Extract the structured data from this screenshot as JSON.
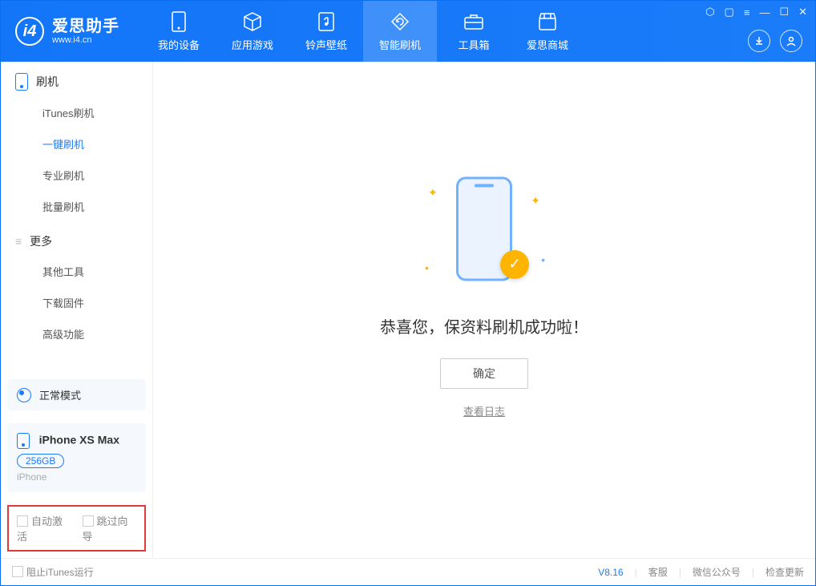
{
  "app": {
    "title": "爱思助手",
    "url": "www.i4.cn"
  },
  "nav": {
    "items": [
      {
        "label": "我的设备",
        "icon": "device"
      },
      {
        "label": "应用游戏",
        "icon": "cube"
      },
      {
        "label": "铃声壁纸",
        "icon": "music"
      },
      {
        "label": "智能刷机",
        "icon": "refresh",
        "active": true
      },
      {
        "label": "工具箱",
        "icon": "toolbox"
      },
      {
        "label": "爱思商城",
        "icon": "store"
      }
    ]
  },
  "sidebar": {
    "section1": {
      "title": "刷机"
    },
    "items1": [
      {
        "label": "iTunes刷机"
      },
      {
        "label": "一键刷机",
        "active": true
      },
      {
        "label": "专业刷机"
      },
      {
        "label": "批量刷机"
      }
    ],
    "section2": {
      "title": "更多"
    },
    "items2": [
      {
        "label": "其他工具"
      },
      {
        "label": "下载固件"
      },
      {
        "label": "高级功能"
      }
    ],
    "mode": {
      "label": "正常模式"
    },
    "device": {
      "name": "iPhone XS Max",
      "storage": "256GB",
      "type": "iPhone"
    },
    "opts": {
      "auto_activate": "自动激活",
      "skip_guide": "跳过向导"
    }
  },
  "main": {
    "success_text": "恭喜您，保资料刷机成功啦！",
    "ok_button": "确定",
    "log_link": "查看日志"
  },
  "footer": {
    "block_itunes": "阻止iTunes运行",
    "version": "V8.16",
    "links": [
      "客服",
      "微信公众号",
      "检查更新"
    ]
  }
}
